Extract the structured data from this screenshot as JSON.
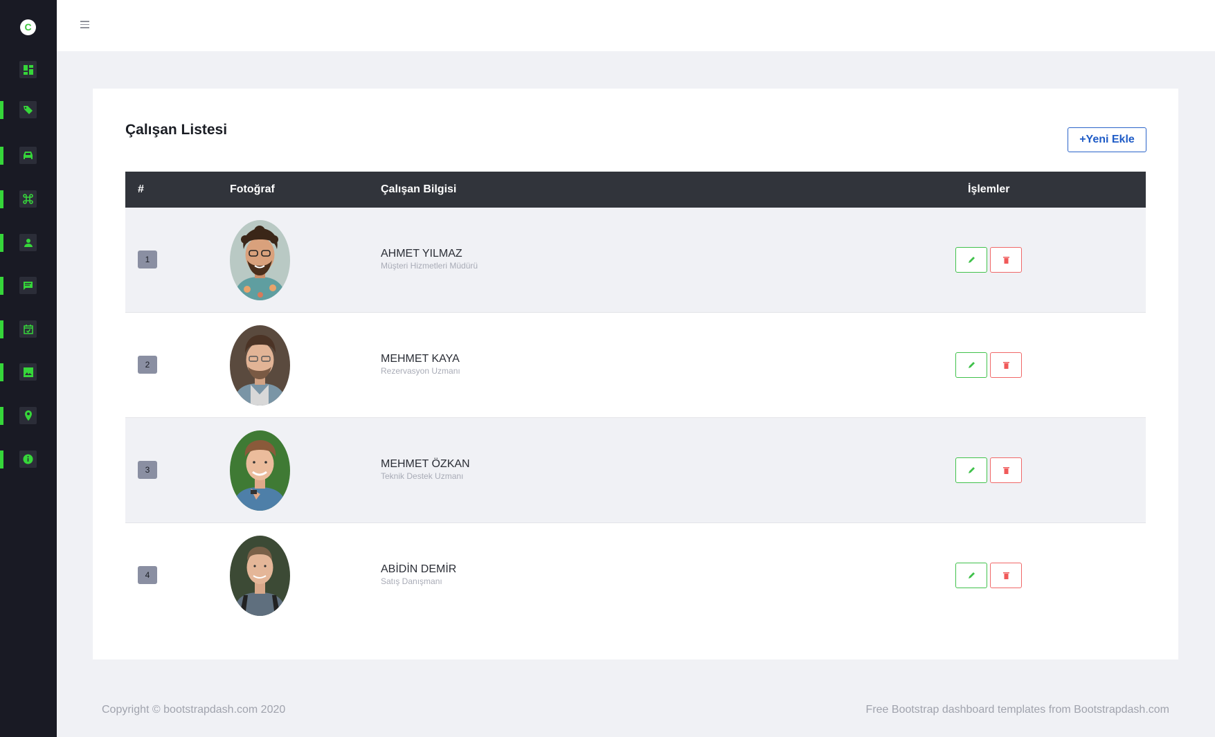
{
  "sidebar": {
    "logo_letter": "C",
    "accent_color": "#36d63a",
    "items": [
      {
        "icon": "dashboard-icon",
        "active": false
      },
      {
        "icon": "tags-icon",
        "active": true
      },
      {
        "icon": "car-icon",
        "active": true
      },
      {
        "icon": "command-icon",
        "active": true
      },
      {
        "icon": "user-icon",
        "active": true
      },
      {
        "icon": "message-icon",
        "active": true
      },
      {
        "icon": "calendar-check-icon",
        "active": true
      },
      {
        "icon": "image-icon",
        "active": true
      },
      {
        "icon": "map-pin-icon",
        "active": true
      },
      {
        "icon": "info-icon",
        "active": true
      }
    ]
  },
  "topbar": {
    "menu_icon": "hamburger-icon"
  },
  "card": {
    "title": "Çalışan Listesi",
    "add_button": {
      "prefix": "+",
      "label": "Yeni Ekle"
    }
  },
  "table": {
    "headers": {
      "index": "#",
      "photo": "Fotoğraf",
      "info": "Çalışan Bilgisi",
      "actions": "İşlemler"
    },
    "rows": [
      {
        "index": "1",
        "name": "AHMET YILMAZ",
        "role": "Müşteri Hizmetleri Müdürü"
      },
      {
        "index": "2",
        "name": "MEHMET KAYA",
        "role": "Rezervasyon Uzmanı"
      },
      {
        "index": "3",
        "name": "MEHMET ÖZKAN",
        "role": "Teknik Destek Uzmanı"
      },
      {
        "index": "4",
        "name": "ABİDİN DEMİR",
        "role": "Satış Danışmanı"
      }
    ]
  },
  "footer": {
    "copyright": "Copyright © bootstrapdash.com 2020",
    "credit": "Free Bootstrap dashboard templates from Bootstrapdash.com"
  }
}
